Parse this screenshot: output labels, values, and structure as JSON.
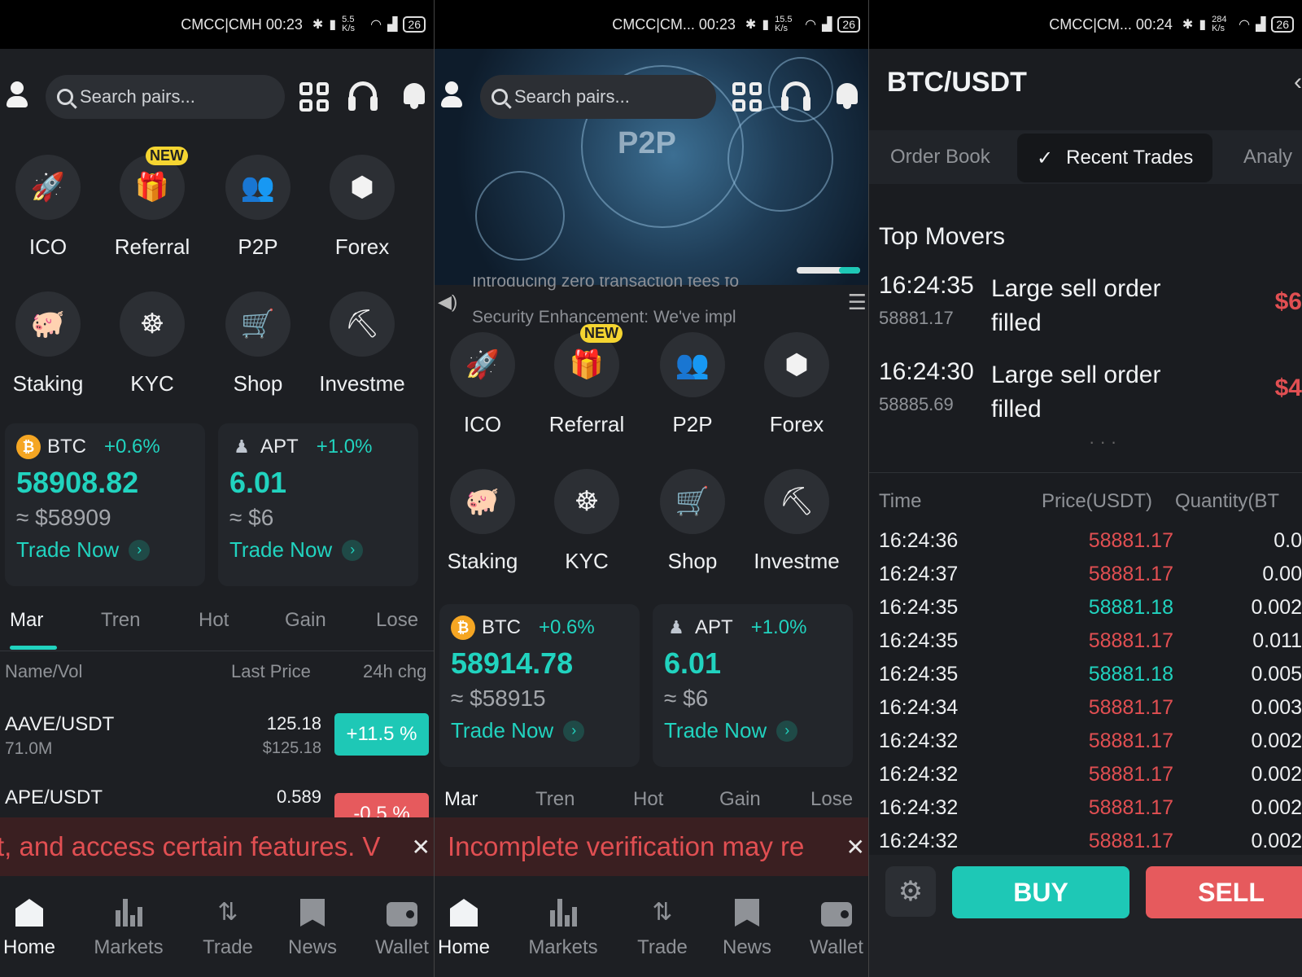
{
  "status_bars": [
    {
      "carrier": "CMCC|CMH 00:23",
      "speed": "5.5 K/s",
      "battery": "26"
    },
    {
      "carrier": "CMCC|CM... 00:23",
      "speed": "15.5 K/s",
      "battery": "26"
    },
    {
      "carrier": "CMCC|CM... 00:24",
      "speed": "284 K/s",
      "battery": "26"
    }
  ],
  "home": {
    "search_placeholder": "Search pairs...",
    "shortcuts": [
      {
        "label": "ICO",
        "icon": "rocket-icon"
      },
      {
        "label": "Referral",
        "icon": "gift-icon",
        "badge": "NEW"
      },
      {
        "label": "P2P",
        "icon": "users-exchange-icon"
      },
      {
        "label": "Forex",
        "icon": "cube-icon"
      },
      {
        "label": "Staking",
        "icon": "piggy-bank-icon"
      },
      {
        "label": "KYC",
        "icon": "fingerprint-icon"
      },
      {
        "label": "Shop",
        "icon": "cart-icon"
      },
      {
        "label": "Investme",
        "icon": "pickaxe-icon"
      }
    ],
    "cards_panel1": [
      {
        "symbol": "BTC",
        "change": "+0.6%",
        "price": "58908.82",
        "approx": "≈ $58909",
        "cta": "Trade Now"
      },
      {
        "symbol": "APT",
        "change": "+1.0%",
        "price": "6.01",
        "approx": "≈ $6",
        "cta": "Trade Now"
      }
    ],
    "cards_panel2": [
      {
        "symbol": "BTC",
        "change": "+0.6%",
        "price": "58914.78",
        "approx": "≈ $58915",
        "cta": "Trade Now"
      },
      {
        "symbol": "APT",
        "change": "+1.0%",
        "price": "6.01",
        "approx": "≈ $6",
        "cta": "Trade Now"
      }
    ],
    "market_tabs": [
      "Mar",
      "Tren",
      "Hot",
      "Gain",
      "Lose"
    ],
    "table_headers": {
      "name": "Name/Vol",
      "last": "Last Price",
      "change": "24h chg"
    },
    "rows": [
      {
        "pair": "AAVE/USDT",
        "vol": "71.0M",
        "last": "125.18",
        "last_usd": "$125.18",
        "change": "+11.5 %"
      },
      {
        "pair": "APE/USDT",
        "vol": "",
        "last": "0.589",
        "last_usd": "",
        "change": "-0.5 %"
      }
    ],
    "warning_panel1": "t, and access certain features. V",
    "warning_panel2": "Incomplete verification may re",
    "nav": [
      "Home",
      "Markets",
      "Trade",
      "News",
      "Wallet"
    ]
  },
  "banner": {
    "text": "P2P",
    "news_line1": "Introducing zero transaction fees fo",
    "news_line2": "Security Enhancement: We've impl"
  },
  "trade_screen": {
    "title": "BTC/USDT",
    "tabs": [
      "Order Book",
      "Recent Trades",
      "Analy"
    ],
    "top_movers_title": "Top Movers",
    "movers": [
      {
        "time": "16:24:35",
        "price": "58881.17",
        "desc": "Large sell order filled",
        "amount": "$6"
      },
      {
        "time": "16:24:30",
        "price": "58885.69",
        "desc": "Large sell order filled",
        "amount": "$4"
      }
    ],
    "headers": {
      "time": "Time",
      "price": "Price(USDT)",
      "qty": "Quantity(BT"
    },
    "trades": [
      {
        "time": "16:24:36",
        "price": "58881.17",
        "qty": "0.0",
        "side": "sell"
      },
      {
        "time": "16:24:37",
        "price": "58881.17",
        "qty": "0.00",
        "side": "sell"
      },
      {
        "time": "16:24:35",
        "price": "58881.18",
        "qty": "0.002",
        "side": "buy"
      },
      {
        "time": "16:24:35",
        "price": "58881.17",
        "qty": "0.011",
        "side": "sell"
      },
      {
        "time": "16:24:35",
        "price": "58881.18",
        "qty": "0.005",
        "side": "buy"
      },
      {
        "time": "16:24:34",
        "price": "58881.17",
        "qty": "0.003",
        "side": "sell"
      },
      {
        "time": "16:24:32",
        "price": "58881.17",
        "qty": "0.002",
        "side": "sell"
      },
      {
        "time": "16:24:32",
        "price": "58881.17",
        "qty": "0.002",
        "side": "sell"
      },
      {
        "time": "16:24:32",
        "price": "58881.17",
        "qty": "0.002",
        "side": "sell"
      },
      {
        "time": "16:24:32",
        "price": "58881.17",
        "qty": "0.002",
        "side": "sell"
      }
    ],
    "buy_label": "BUY",
    "sell_label": "SELL"
  },
  "colors": {
    "accent": "#21d3bf",
    "sell": "#e65a5d",
    "buy": "#1ec8b6",
    "sell_text": "#e14f52",
    "buy_text": "#21d3bf"
  }
}
